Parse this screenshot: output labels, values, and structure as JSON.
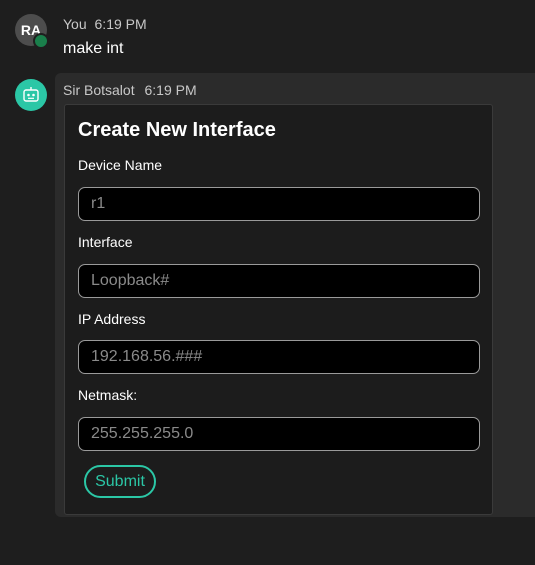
{
  "user_message": {
    "avatar_initials": "RA",
    "sender": "You",
    "time": "6:19 PM",
    "text": "make int",
    "presence_color": "#1a7f4b"
  },
  "bot_message": {
    "avatar_icon": "bot-icon",
    "sender": "Sir Botsalot",
    "time": "6:19 PM",
    "accent_color": "#2bc7a6"
  },
  "form": {
    "title": "Create New Interface",
    "fields": [
      {
        "label": "Device Name",
        "value": "",
        "placeholder": "r1"
      },
      {
        "label": "Interface",
        "value": "",
        "placeholder": "Loopback#"
      },
      {
        "label": "IP Address",
        "value": "",
        "placeholder": "192.168.56.###"
      },
      {
        "label": "Netmask:",
        "value": "",
        "placeholder": "255.255.255.0"
      }
    ],
    "submit_label": "Submit"
  }
}
